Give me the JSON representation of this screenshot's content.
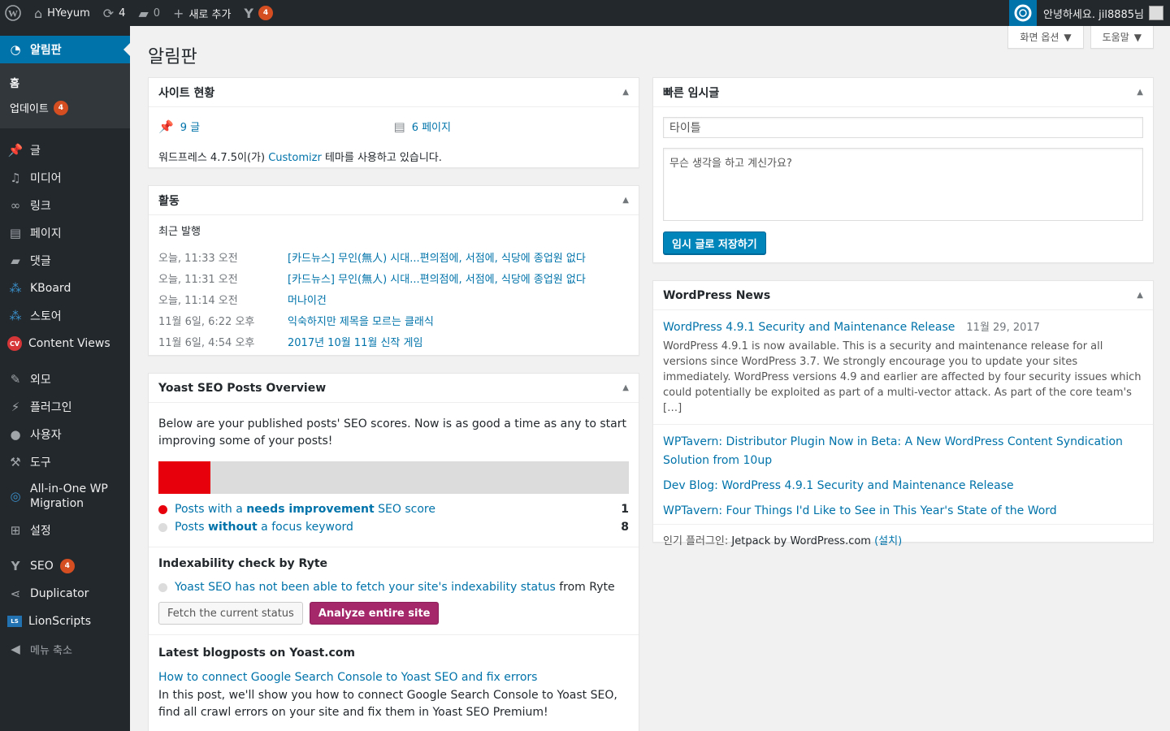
{
  "adminbar": {
    "site_name": "HYeyum",
    "updates_count": "4",
    "comments_count": "0",
    "new_label": "새로 추가",
    "yoast_badge": "4",
    "howdy": "안녕하세요. jil8885님"
  },
  "sidebar": {
    "dashboard": "알림판",
    "home": "홈",
    "updates": "업데이트",
    "updates_badge": "4",
    "posts": "글",
    "media": "미디어",
    "links": "링크",
    "pages": "페이지",
    "comments": "댓글",
    "kboard": "KBoard",
    "store": "스토어",
    "content_views": "Content Views",
    "cv_icon_text": "CV",
    "appearance": "외모",
    "plugins": "플러그인",
    "users": "사용자",
    "tools": "도구",
    "migration": "All-in-One WP Migration",
    "settings": "설정",
    "seo": "SEO",
    "seo_badge": "4",
    "duplicator": "Duplicator",
    "lionscripts": "LionScripts",
    "ls_icon_text": "LS",
    "collapse": "메뉴 축소"
  },
  "header": {
    "screen_options": "화면 옵션",
    "help": "도움말",
    "title": "알림판"
  },
  "glance": {
    "title": "사이트 현황",
    "posts": "9 글",
    "pages": "6 페이지",
    "wp_prefix": "워드프레스 4.7.5이(가) ",
    "theme": "Customizr",
    "wp_suffix": " 테마를 사용하고 있습니다."
  },
  "activity": {
    "title": "활동",
    "subtitle": "최근 발행",
    "rows": [
      {
        "time": "오늘, 11:33 오전",
        "title": "[카드뉴스] 무인(無人) 시대...편의점에, 서점에, 식당에 종업원 없다"
      },
      {
        "time": "오늘, 11:31 오전",
        "title": "[카드뉴스] 무인(無人) 시대...편의점에, 서점에, 식당에 종업원 없다"
      },
      {
        "time": "오늘, 11:14 오전",
        "title": "머나이건"
      },
      {
        "time": "11월 6일, 6:22 오후",
        "title": "익숙하지만 제목을 모르는 클래식"
      },
      {
        "time": "11월 6일, 4:54 오후",
        "title": "2017년 10월 11월 신작 게임"
      }
    ]
  },
  "yoast": {
    "title": "Yoast SEO Posts Overview",
    "intro": "Below are your published posts' SEO scores. Now is as good a time as any to start improving some of your posts!",
    "row1_a": "Posts with a ",
    "row1_b": "needs improvement",
    "row1_c": " SEO score",
    "row1_count": "1",
    "row2_a": "Posts ",
    "row2_b": "without",
    "row2_c": " a focus keyword",
    "row2_count": "8",
    "needs_improvement_fraction": 0.11,
    "ryte_title": "Indexability check by Ryte",
    "ryte_link": "Yoast SEO has not been able to fetch your site's indexability status",
    "ryte_suffix": " from Ryte",
    "fetch_button": "Fetch the current status",
    "analyze_button": "Analyze entire site",
    "blog_title": "Latest blogposts on Yoast.com",
    "blog_link": "How to connect Google Search Console to Yoast SEO and fix errors",
    "blog_excerpt": "In this post, we'll show you how to connect Google Search Console to Yoast SEO, find all crawl errors on your site and fix them in Yoast SEO Premium!",
    "colors": {
      "red": "#e7000b",
      "grey": "#dcdcdc",
      "pink": "#a4286a"
    }
  },
  "quickdraft": {
    "title": "빠른 임시글",
    "title_placeholder": "타이틀",
    "content_placeholder": "무슨 생각을 하고 계신가요?",
    "save_button": "임시 글로 저장하기"
  },
  "news": {
    "title": "WordPress News",
    "main_link": "WordPress 4.9.1 Security and Maintenance Release",
    "main_date": "11월 29, 2017",
    "main_excerpt": "WordPress 4.9.1 is now available. This is a security and maintenance release for all versions since WordPress 3.7. We strongly encourage you to update your sites immediately. WordPress versions 4.9 and earlier are affected by four security issues which could potentially be exploited as part of a multi-vector attack. As part of the core team's […]",
    "links": [
      "WPTavern: Distributor Plugin Now in Beta: A New WordPress Content Syndication Solution from 10up",
      "Dev Blog: WordPress 4.9.1 Security and Maintenance Release",
      "WPTavern: Four Things I'd Like to See in This Year's State of the Word"
    ],
    "popular_prefix": "인기 플러그인: ",
    "popular_plugin": "Jetpack by WordPress.com",
    "install": "(설치)"
  },
  "colors": {
    "adminbar": "#23282d",
    "accent": "#0073aa",
    "badge": "#d54e21"
  }
}
